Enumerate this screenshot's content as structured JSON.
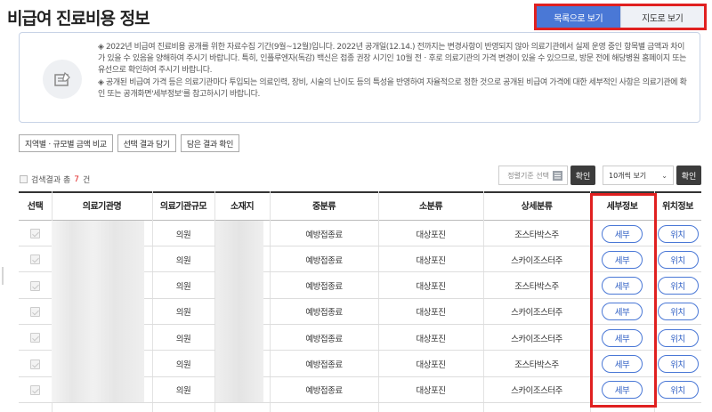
{
  "page": {
    "title": "비급여 진료비용 정보"
  },
  "view_toggle": {
    "list_label": "목록으로 보기",
    "map_label": "지도로 보기"
  },
  "notice": {
    "icon": "document-pencil-icon",
    "paragraph1": "◈ 2022년 비급여 진료비용 공개를 위한 자료수집 기간(9월~12월)입니다. 2022년 공개일(12.14.) 전까지는 변경사항이 반영되지 않아 의료기관에서 실제 운영 중인 항목별 금액과 차이가 있을 수 있음을 양해하여 주시기 바랍니다. 특히, 인플루엔자(독감) 백신은 접종 권장 시기인 10월 전ㆍ후로 의료기관의 가격 변경이 있을 수 있으므로, 방문 전에 해당병원 홈페이지 또는 유선으로 확인하여 주시기 바랍니다.",
    "paragraph2": "◈ 공개된 비급여 가격 등은 의료기관마다 투입되는 의료인력, 장비, 시술의 난이도 등의 특성을 반영하여 자율적으로 정한 것으로 공개된 비급여 가격에 대한 세부적인 사항은 의료기관에 확인 또는 공개화면'세부정보'를 참고하시기 바랍니다."
  },
  "filters": {
    "compare_label": "지역별ㆍ규모별 금액 비교",
    "save_label": "선택 결과 담기",
    "view_saved_label": "담은 결과 확인"
  },
  "results": {
    "prefix": "검색결과 총",
    "count": "7",
    "suffix": "건"
  },
  "sort": {
    "placeholder": "정렬기준 선택",
    "confirm_label": "확인",
    "icon": "list-icon"
  },
  "page_size": {
    "value": "10개씩 보기",
    "confirm_label": "확인",
    "icon": "chevron-down-icon"
  },
  "table": {
    "headers": [
      "선택",
      "의료기관명",
      "의료기관규모",
      "소재지",
      "중분류",
      "소분류",
      "상세분류",
      "세부정보",
      "위치정보"
    ],
    "rows": [
      {
        "size": "의원",
        "category": "예방접종료",
        "subcategory": "대상포진",
        "detail": "조스타박스주",
        "detail_btn": "세부",
        "location_btn": "위치"
      },
      {
        "size": "의원",
        "category": "예방접종료",
        "subcategory": "대상포진",
        "detail": "스카이조스터주",
        "detail_btn": "세부",
        "location_btn": "위치"
      },
      {
        "size": "의원",
        "category": "예방접종료",
        "subcategory": "대상포진",
        "detail": "조스타박스주",
        "detail_btn": "세부",
        "location_btn": "위치"
      },
      {
        "size": "의원",
        "category": "예방접종료",
        "subcategory": "대상포진",
        "detail": "스카이조스터주",
        "detail_btn": "세부",
        "location_btn": "위치"
      },
      {
        "size": "의원",
        "category": "예방접종료",
        "subcategory": "대상포진",
        "detail": "스카이조스터주",
        "detail_btn": "세부",
        "location_btn": "위치"
      },
      {
        "size": "의원",
        "category": "예방접종료",
        "subcategory": "대상포진",
        "detail": "조스타박스주",
        "detail_btn": "세부",
        "location_btn": "위치"
      },
      {
        "size": "의원",
        "category": "예방접종료",
        "subcategory": "대상포진",
        "detail": "스카이조스터주",
        "detail_btn": "세부",
        "location_btn": "위치"
      }
    ]
  },
  "colors": {
    "highlight": "#e02020",
    "primary": "#4a78d6",
    "dark_button": "#3c3c3c"
  }
}
